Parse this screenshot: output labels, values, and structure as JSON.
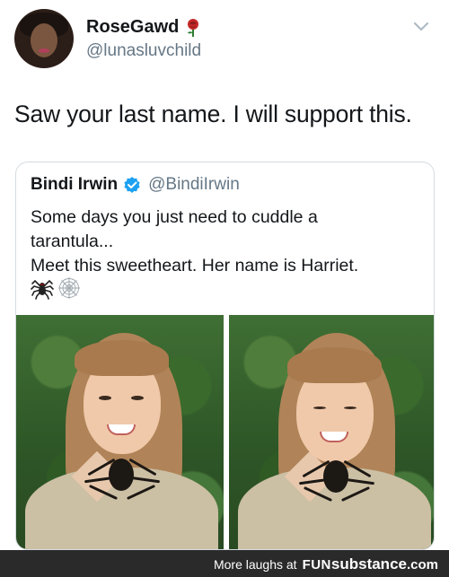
{
  "tweet": {
    "display_name": "RoseGawd",
    "handle": "@lunasluvchild",
    "text": "Saw your last name. I will support this.",
    "name_emoji_icon": "rose-icon"
  },
  "quoted_tweet": {
    "display_name": "Bindi Irwin",
    "handle": "@BindiIrwin",
    "verified": true,
    "text_lines": [
      "Some days you just need to cuddle a",
      "tarantula...",
      "Meet this sweetheart. Her name is Harriet."
    ],
    "emoji_icons": [
      "spider-icon",
      "spider-web-icon"
    ],
    "photo_count": 2
  },
  "footer": {
    "caption": "More laughs at",
    "brand_fun": "FUN",
    "brand_substance": "substance",
    "brand_tld": ".com"
  },
  "colors": {
    "text": "#14171a",
    "secondary": "#657786",
    "verified_blue": "#1da1f2",
    "border": "#d4dbe0",
    "footer_bg": "#2a2a2a"
  }
}
